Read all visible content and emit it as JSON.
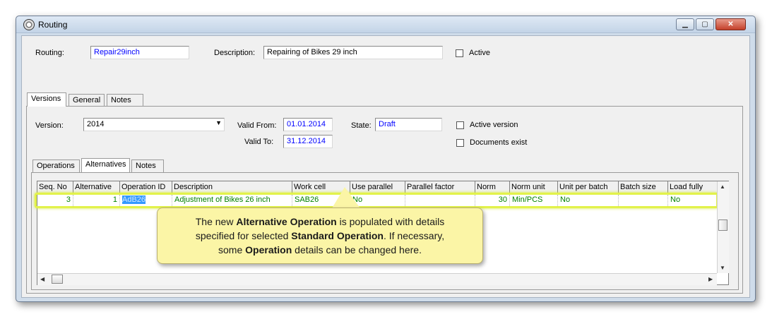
{
  "window": {
    "title": "Routing"
  },
  "header": {
    "routing_label": "Routing:",
    "routing_value": "Repair29inch",
    "description_label": "Description:",
    "description_value": "Repairing of Bikes 29 inch",
    "active_label": "Active"
  },
  "main_tabs": [
    "Versions",
    "General",
    "Notes"
  ],
  "version": {
    "version_label": "Version:",
    "version_value": "2014",
    "valid_from_label": "Valid From:",
    "valid_from_value": "01.01.2014",
    "valid_to_label": "Valid To:",
    "valid_to_value": "31.12.2014",
    "state_label": "State:",
    "state_value": "Draft",
    "active_version_label": "Active version",
    "documents_exist_label": "Documents exist"
  },
  "sub_tabs": [
    "Operations",
    "Alternatives",
    "Notes"
  ],
  "grid": {
    "columns": [
      "Seq. No",
      "Alternative",
      "Operation ID",
      "Description",
      "Work cell",
      "Use parallel",
      "Parallel factor",
      "Norm",
      "Norm unit",
      "Unit per batch",
      "Batch size",
      "Load fully"
    ],
    "rows": [
      [
        "3",
        "1",
        "AdB26",
        "Adjustment of Bikes 26 inch",
        "SAB26",
        "No",
        "",
        "30",
        "Min/PCS",
        "No",
        "",
        "No"
      ]
    ]
  },
  "callout": {
    "t1": "The new ",
    "b1": "Alternative Operation",
    "t2": " is populated with details",
    "t3": "specified for selected ",
    "b2": "Standard Operation",
    "t4": ". If necessary,",
    "t5": "some ",
    "b3": "Operation",
    "t6": " details can be changed here."
  },
  "colors": {
    "highlight": "#e2f24a",
    "callout_bg": "#fbf5a6",
    "row_text": "#008000",
    "selection": "#3399ff"
  }
}
